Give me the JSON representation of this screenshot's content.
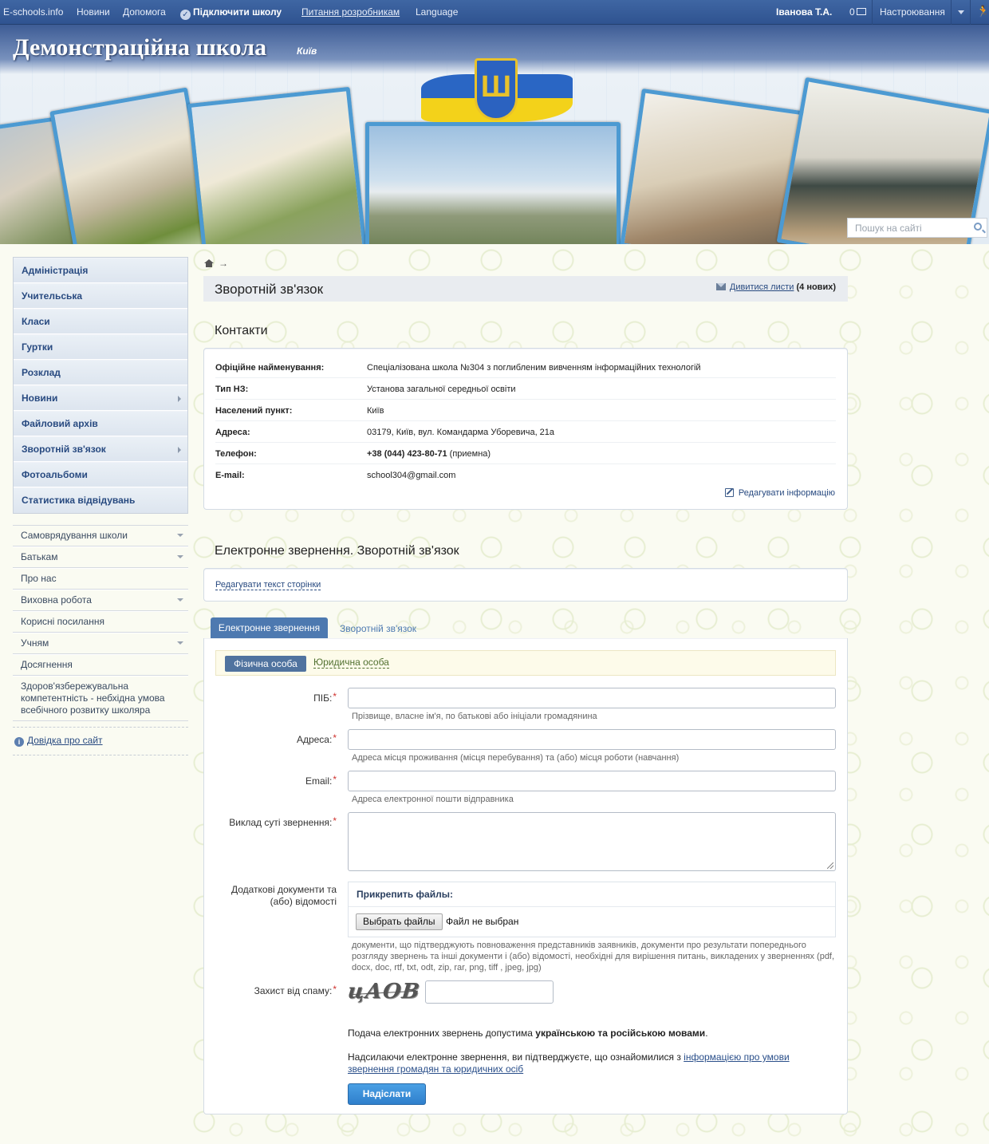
{
  "topbar": {
    "site": "E-schools.info",
    "news": "Новини",
    "help": "Допомога",
    "connect": "Підключити школу",
    "developers": "Питання розробникам",
    "language": "Language",
    "user": "Іванова Т.А.",
    "messages_count": "0",
    "settings": "Настроювання"
  },
  "header": {
    "title": "Демонстраційна школа",
    "city": "Київ",
    "search_placeholder": "Пошук на сайті"
  },
  "sidebar": {
    "main_items": [
      {
        "label": "Адміністрація"
      },
      {
        "label": "Учительська"
      },
      {
        "label": "Класи"
      },
      {
        "label": "Гуртки"
      },
      {
        "label": "Розклад"
      },
      {
        "label": "Новини"
      },
      {
        "label": "Файловий архів"
      },
      {
        "label": "Зворотній зв'язок"
      },
      {
        "label": "Фотоальбоми"
      },
      {
        "label": "Статистика відвідувань"
      }
    ],
    "extra_items": [
      {
        "label": "Самоврядування школи"
      },
      {
        "label": "Батькам"
      },
      {
        "label": "Про нас"
      },
      {
        "label": "Виховна робота"
      },
      {
        "label": "Корисні посилання"
      },
      {
        "label": "Учням"
      },
      {
        "label": "Досягнення"
      },
      {
        "label": "Здоров'язбережувальна компетентність - небхідна умова всебічного розвитку школяра"
      }
    ],
    "help_link": "Довідка про сайт"
  },
  "breadcrumb": {
    "arrow": "→"
  },
  "page": {
    "title": "Зворотній зв'язок",
    "view_letters_link": "Дивитися листи",
    "new_count": "(4 нових)"
  },
  "contacts": {
    "title": "Контакти",
    "rows": [
      {
        "key": "Офіційне найменування:",
        "value": "Спеціалізована школа №304 з поглибленим вивченням інформаційних технологій"
      },
      {
        "key": "Тип НЗ:",
        "value": "Установа загальної середньої освіти"
      },
      {
        "key": "Населений пункт:",
        "value": "Київ"
      },
      {
        "key": "Адреса:",
        "value": "03179, Київ, вул. Командарма Уборевича, 21а"
      },
      {
        "key": "Телефон:",
        "value_bold": "+38 (044) 423-80-71",
        "value_rest": " (приемна)"
      },
      {
        "key": "E-mail:",
        "value": "school304@gmail.com"
      }
    ],
    "edit_link": "Редагувати інформацію"
  },
  "appeal": {
    "title": "Електронне звернення. Зворотній зв'язок",
    "edit_page_text": "Редагувати текст сторінки",
    "tab_active": "Електронне звернення",
    "tab_other": "Зворотній зв'язок",
    "person_physical": "Фізична особа",
    "person_legal": "Юридична особа"
  },
  "form": {
    "name_label": "ПІБ:",
    "name_hint": "Прізвище, власне ім'я, по батькові або ініціали громадянина",
    "address_label": "Адреса:",
    "address_hint": "Адреса місця проживання (місця перебування) та (або) місця роботи (навчання)",
    "email_label": "Email:",
    "email_hint": "Адреса електронної пошти відправника",
    "essence_label": "Виклад суті звернення:",
    "docs_label": "Додаткові документи та (або) відомості",
    "attach_title": "Прикрепить файлы:",
    "choose_button": "Выбрать файлы",
    "no_file": "Файл не выбран",
    "docs_hint": "документи, що підтверджують повноваження представників заявників, документи про результати попереднього розгляду звернень та інші документи і (або) відомості, необхідні для вирішення питань, викладених у зверненнях (pdf, docx, doc, rtf, txt, odt, zip, rar, png, tiff , jpeg, jpg)",
    "spam_label": "Захист від спаму:",
    "captcha_text": "цАОВ",
    "note1_pre": "Подача електронних звернень допустима ",
    "note1_bold": "українською та російською мовами",
    "note1_post": ".",
    "note2_pre": "Надсилаючи електронне звернення, ви підтверджуєте, що ознайомилися з ",
    "note2_link": "інформацією про умови звернення громадян та юридичних осіб",
    "submit": "Надіслати",
    "required_mark": "*"
  }
}
